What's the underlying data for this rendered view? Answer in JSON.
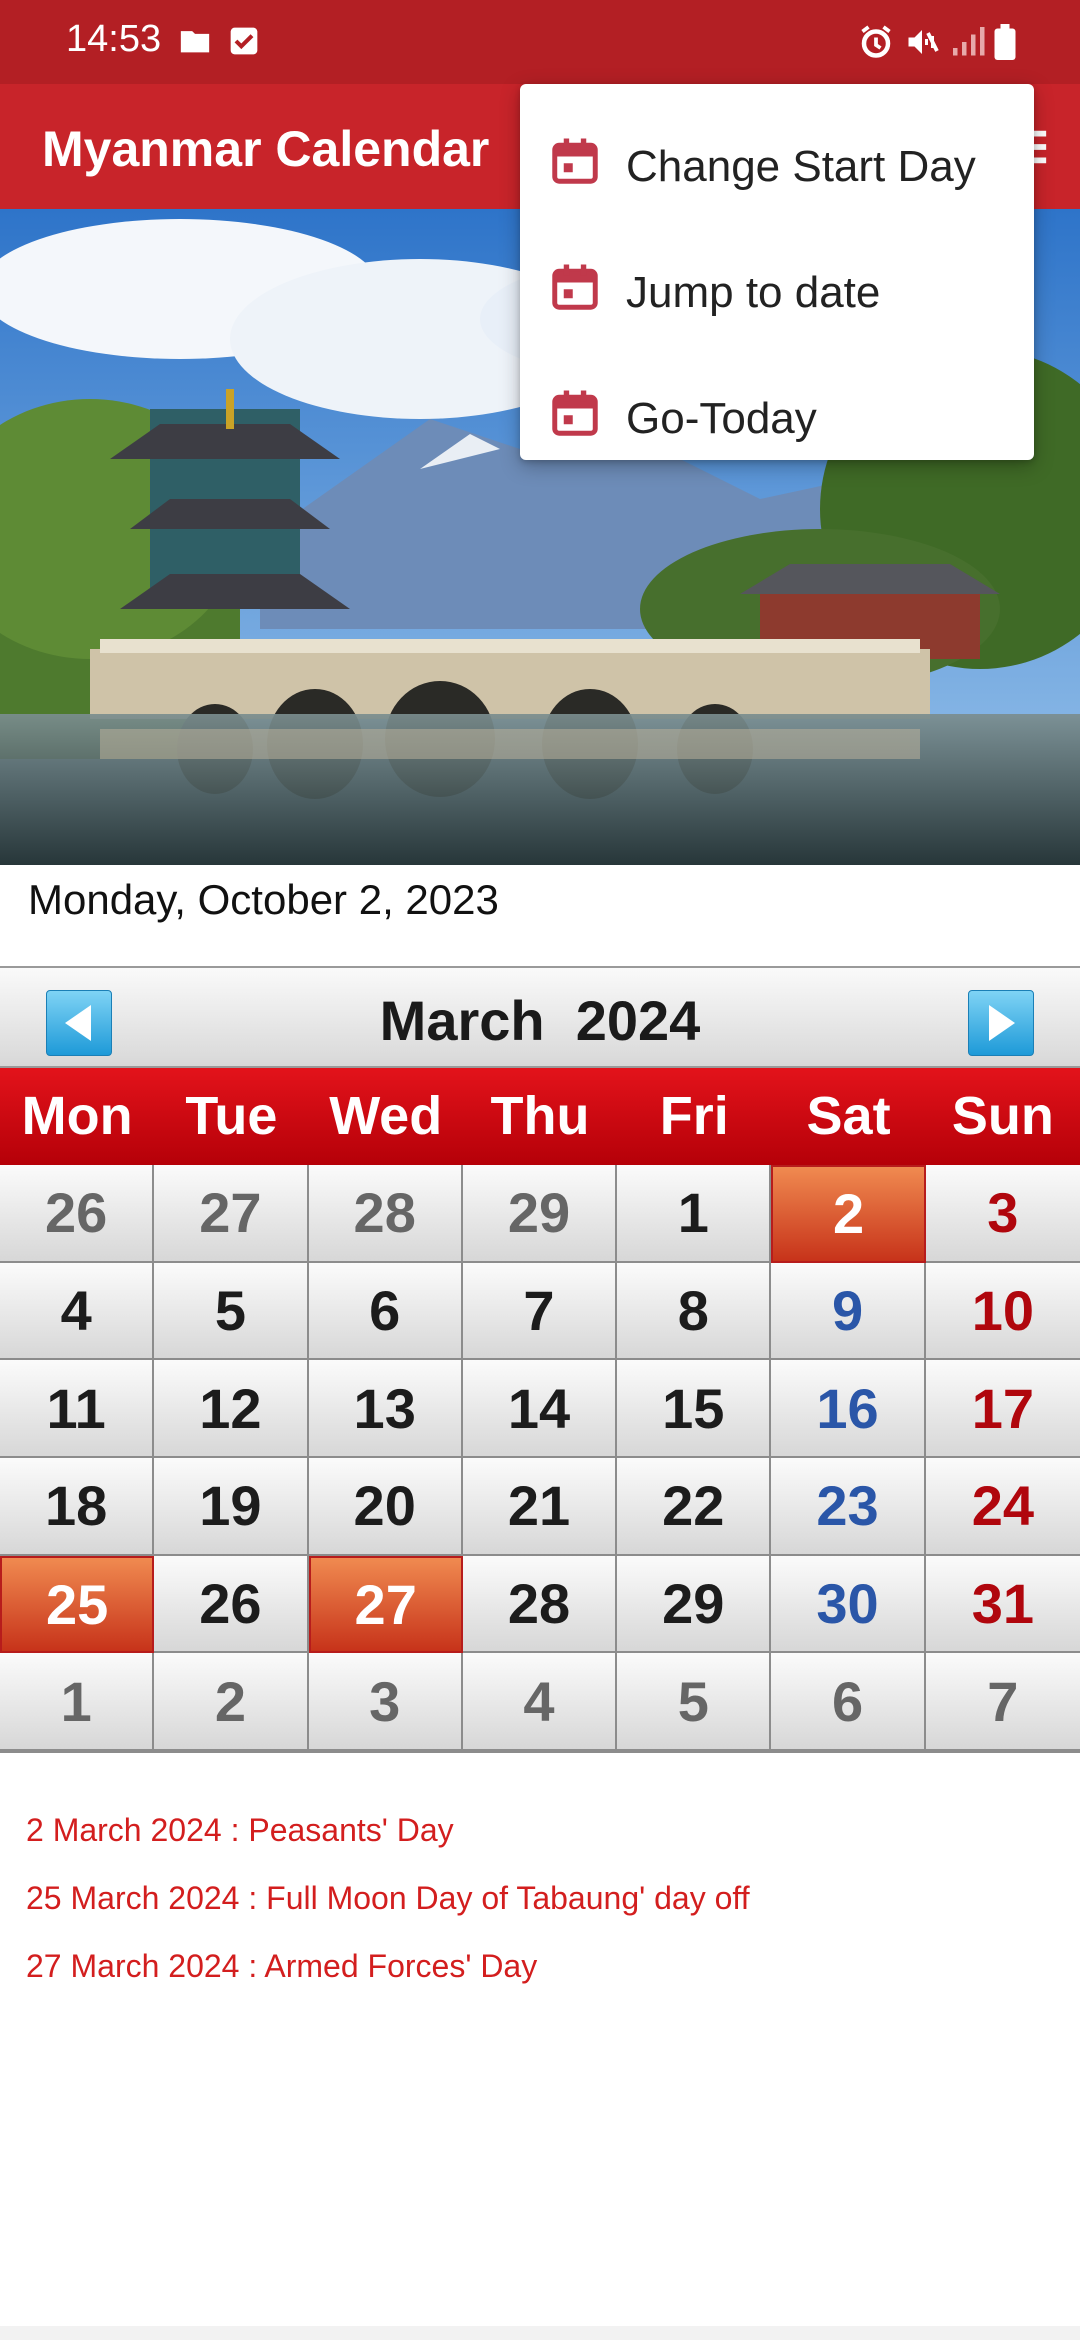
{
  "status_bar": {
    "time": "14:53"
  },
  "app_bar": {
    "title": "Myanmar Calendar"
  },
  "menu": {
    "items": [
      {
        "label": "Change Start Day",
        "icon": "calendar-icon"
      },
      {
        "label": "Jump to date",
        "icon": "calendar-icon"
      },
      {
        "label": "Go-Today",
        "icon": "calendar-icon"
      }
    ]
  },
  "today_text": "Monday, October 2, 2023",
  "calendar": {
    "month_year": "March  2024",
    "weekdays": [
      "Mon",
      "Tue",
      "Wed",
      "Thu",
      "Fri",
      "Sat",
      "Sun"
    ],
    "weeks": [
      [
        "26",
        "27",
        "28",
        "29",
        "1",
        "2",
        "3"
      ],
      [
        "4",
        "5",
        "6",
        "7",
        "8",
        "9",
        "10"
      ],
      [
        "11",
        "12",
        "13",
        "14",
        "15",
        "16",
        "17"
      ],
      [
        "18",
        "19",
        "20",
        "21",
        "22",
        "23",
        "24"
      ],
      [
        "25",
        "26",
        "27",
        "28",
        "29",
        "30",
        "31"
      ],
      [
        "1",
        "2",
        "3",
        "4",
        "5",
        "6",
        "7"
      ]
    ],
    "holidays": [
      "2",
      "25",
      "27"
    ]
  },
  "events": [
    "2 March 2024 : Peasants' Day",
    "25 March 2024 : Full Moon Day of Tabaung' day off",
    "27 March 2024 : Armed Forces' Day"
  ],
  "colors": {
    "primary": "#c8242a",
    "status_bar": "#b31f24",
    "weekday_header": "#d50d15",
    "holiday_cell": "#e0602f",
    "saturday_text": "#2a56a8",
    "sunday_text": "#b0060d",
    "event_text": "#d31e1e"
  }
}
